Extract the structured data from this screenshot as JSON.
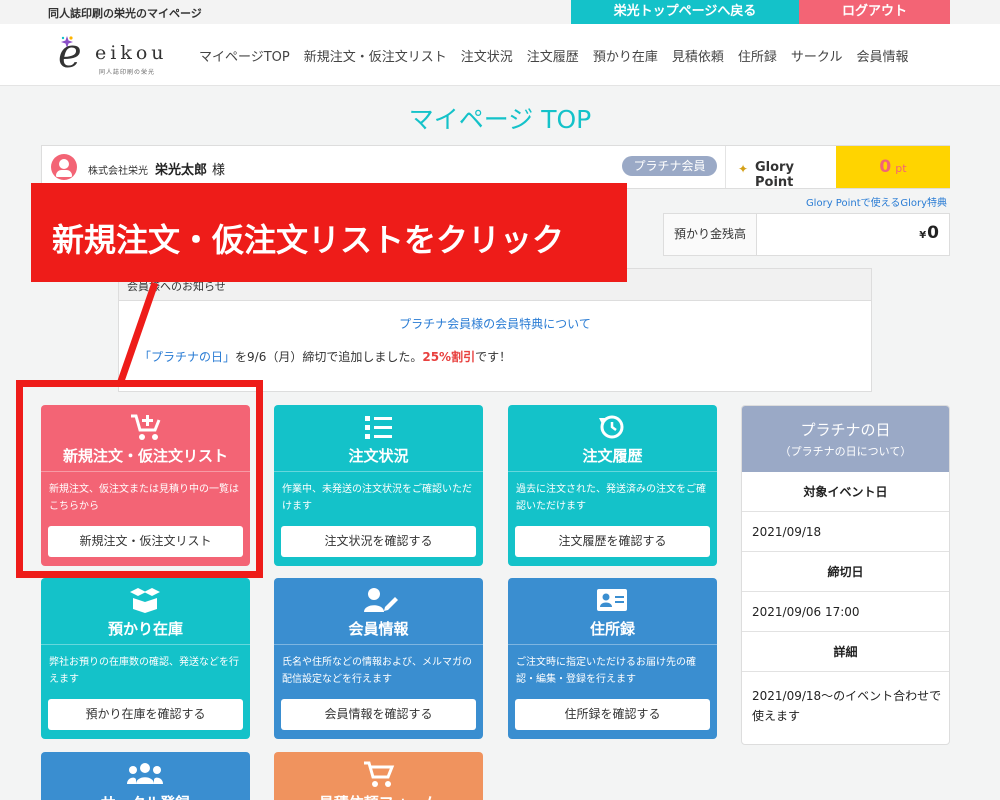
{
  "topbar": {
    "site_caption": "同人誌印刷の栄光のマイページ",
    "home_link": "栄光トップページへ戻る",
    "logout": "ログアウト"
  },
  "logo": {
    "word": "eikou",
    "sub": "同人誌印刷の栄光"
  },
  "nav": [
    "マイページTOP",
    "新規注文・仮注文リスト",
    "注文状況",
    "注文履歴",
    "預かり在庫",
    "見積依頼",
    "住所録",
    "サークル",
    "会員情報"
  ],
  "page_title": "マイページ TOP",
  "user": {
    "company": "株式会社栄光",
    "name": "栄光太郎",
    "honorific": "様",
    "rank": "プラチナ会員",
    "glory_label": "Glory Point",
    "points": "0",
    "points_unit": "pt"
  },
  "glory_link": "Glory Pointで使えるGlory特典",
  "balance": {
    "label": "預かり金残高",
    "currency": "¥",
    "value": "0"
  },
  "notice": {
    "head": "会員様へのお知らせ",
    "link": "プラチナ会員様の会員特典について",
    "text_pre": "「プラチナの日」",
    "text_mid": "を9/6（月）締切で追加しました。",
    "text_red": "25%割引",
    "text_post": "です！"
  },
  "cards": [
    {
      "title": "新規注文・仮注文リスト",
      "desc": "新規注文、仮注文または見積り中の一覧はこちらから",
      "button": "新規注文・仮注文リスト",
      "color": "#f36475",
      "icon": "cart-plus-icon"
    },
    {
      "title": "注文状況",
      "desc": "作業中、未発送の注文状況をご確認いただけます",
      "button": "注文状況を確認する",
      "color": "#14c2c9",
      "icon": "list-icon"
    },
    {
      "title": "注文履歴",
      "desc": "過去に注文された、発送済みの注文をご確認いただけます",
      "button": "注文履歴を確認する",
      "color": "#14c2c9",
      "icon": "history-icon"
    },
    {
      "title": "預かり在庫",
      "desc": "弊社お預りの在庫数の確認、発送などを行えます",
      "button": "預かり在庫を確認する",
      "color": "#14c2c9",
      "icon": "box-open-icon"
    },
    {
      "title": "会員情報",
      "desc": "氏名や住所などの情報および、メルマガの配信設定などを行えます",
      "button": "会員情報を確認する",
      "color": "#3a8ed0",
      "icon": "user-edit-icon"
    },
    {
      "title": "住所録",
      "desc": "ご注文時に指定いただけるお届け先の確認・編集・登録を行えます",
      "button": "住所録を確認する",
      "color": "#3a8ed0",
      "icon": "address-card-icon"
    },
    {
      "title": "サークル登録",
      "color": "#3a8ed0",
      "icon": "users-icon"
    },
    {
      "title": "見積依頼フォーム",
      "color": "#f0935e",
      "icon": "cart-icon"
    }
  ],
  "event": {
    "title": "プラチナの日",
    "sub": "（プラチナの日について）",
    "target_label": "対象イベント日",
    "target_value": "2021/09/18",
    "deadline_label": "締切日",
    "deadline_value": "2021/09/06 17:00",
    "detail_label": "詳細",
    "detail_value": "2021/09/18〜のイベント合わせで使えます"
  },
  "overlay": {
    "instruction": "新規注文・仮注文リストをクリック"
  }
}
